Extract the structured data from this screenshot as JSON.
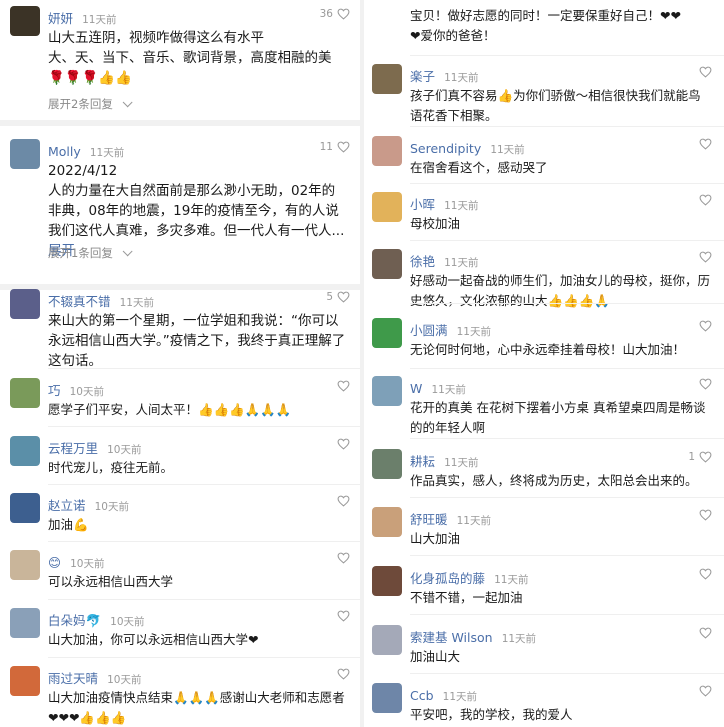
{
  "left": [
    {
      "name": "妍妍",
      "time": "11天前",
      "likes": "36",
      "text": "山大五连阴，视频咋做得这么有水平\n大、天、当下、音乐、歌词背景，高度相融的美🌹🌹🌹👍👍",
      "replies": "展开2条回复",
      "avatar_color": "#3b3326"
    },
    {
      "name": "Molly",
      "time": "11天前",
      "likes": "11",
      "text": "2022/4/12\n人的力量在大自然面前是那么渺小无助，02年的非典，08年的地震，19年的疫情至今，有的人说我们这代人真难，多灾多难。但一代人有一代人...",
      "expand": "展开",
      "replies": "展开1条回复",
      "avatar_color": "#6c8aa6"
    },
    {
      "name": "不辍真不错",
      "time": "11天前",
      "likes": "5",
      "text": "来山大的第一个星期，一位学姐和我说：“你可以永远相信山西大学。”疫情之下，我终于真正理解了这句话。",
      "avatar_color": "#5b5f8a"
    },
    {
      "name": "巧",
      "time": "10天前",
      "likes": "",
      "text": "愿学子们平安，人间太平！👍👍👍🙏🙏🙏",
      "avatar_color": "#7a9a5a"
    },
    {
      "name": "云程万里",
      "time": "10天前",
      "likes": "",
      "text": "时代宠儿，疫往无前。",
      "avatar_color": "#5b8fa8"
    },
    {
      "name": "赵立诺",
      "time": "10天前",
      "likes": "",
      "text": "加油💪",
      "avatar_color": "#3d5f8f"
    },
    {
      "name": "😊",
      "time": "10天前",
      "likes": "",
      "text": "可以永远相信山西大学",
      "avatar_color": "#c9b59a"
    },
    {
      "name": "白朵妈🐬",
      "time": "10天前",
      "likes": "",
      "text": "山大加油，你可以永远相信山西大学❤",
      "avatar_color": "#8aa0b8"
    },
    {
      "name": "雨过天晴",
      "time": "10天前",
      "likes": "",
      "text": "山大加油疫情快点结束🙏🙏🙏感谢山大老师和志愿者❤❤❤👍👍👍",
      "avatar_color": "#d2693a"
    }
  ],
  "right": [
    {
      "name": "",
      "time": "",
      "likes": "",
      "text": "宝贝！做好志愿的同时！一定要保重好自己！❤❤\n❤爱你的爸爸！",
      "avatar_color": ""
    },
    {
      "name": "楽子",
      "time": "11天前",
      "likes": "",
      "text": "孩子们真不容易👍为你们骄傲～相信很快我们就能鸟语花香下相聚。",
      "avatar_color": "#7d6b4e"
    },
    {
      "name": "Serendipity",
      "time": "11天前",
      "likes": "",
      "text": "在宿舍看这个，感动哭了",
      "avatar_color": "#c99a8a"
    },
    {
      "name": "小晖",
      "time": "11天前",
      "likes": "",
      "text": "母校加油",
      "avatar_color": "#e2b25a"
    },
    {
      "name": "徐艳",
      "time": "11天前",
      "likes": "",
      "text": "好感动一起奋战的师生们，加油女儿的母校，挺你，历史悠久，文化浓郁的山大👍👍👍🙏",
      "avatar_color": "#6f5f52"
    },
    {
      "name": "小圆满",
      "time": "11天前",
      "likes": "",
      "text": "无论何时何地，心中永远牵挂着母校！山大加油！",
      "avatar_color": "#3f9a4a"
    },
    {
      "name": "W",
      "time": "11天前",
      "likes": "",
      "text": "花开的真美 在花树下摆着小方桌 真希望桌四周是畅谈的的年轻人啊",
      "avatar_color": "#7ea0b8"
    },
    {
      "name": "耕耘",
      "time": "11天前",
      "likes": "1",
      "text": "作品真实，感人，终将成为历史，太阳总会出来的。",
      "avatar_color": "#6b7f6b"
    },
    {
      "name": "舒旺暖",
      "time": "11天前",
      "likes": "",
      "text": "山大加油",
      "avatar_color": "#c9a07a"
    },
    {
      "name": "化身孤岛的藤",
      "time": "11天前",
      "likes": "",
      "text": "不错不错，一起加油",
      "avatar_color": "#6e4a3a"
    },
    {
      "name": "索建基 Wilson",
      "time": "11天前",
      "likes": "",
      "text": "加油山大",
      "avatar_color": "#a4a9b8"
    },
    {
      "name": "Ccb",
      "time": "11天前",
      "likes": "",
      "text": "平安吧，我的学校，我的爱人",
      "avatar_color": "#6e86a8"
    }
  ]
}
